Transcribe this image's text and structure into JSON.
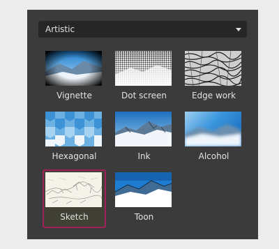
{
  "filter_select": {
    "value": "Artistic",
    "icon": "caret-down-icon"
  },
  "effects": [
    {
      "label": "Vignette"
    },
    {
      "label": "Dot screen"
    },
    {
      "label": "Edge work"
    },
    {
      "label": "Hexagonal"
    },
    {
      "label": "Ink"
    },
    {
      "label": "Alcohol"
    },
    {
      "label": "Sketch",
      "selected": true
    },
    {
      "label": "Toon"
    }
  ],
  "colors": {
    "selection_border": "#a0205a",
    "panel_bg": "#3b3b3b"
  }
}
